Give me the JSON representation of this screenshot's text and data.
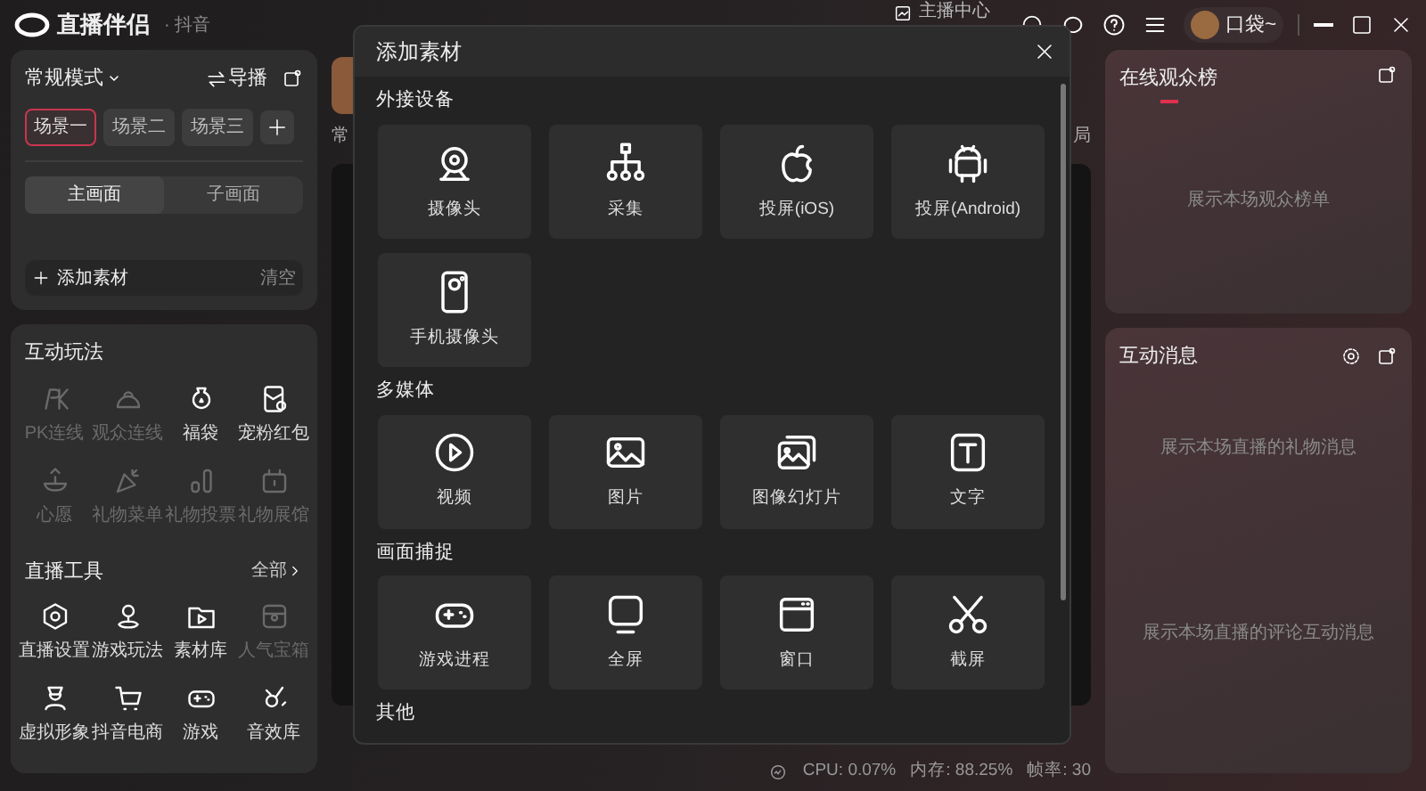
{
  "app": {
    "title": "直播伴侣",
    "platform": "· 抖音"
  },
  "top_bar": {
    "anchor_center": "主播中心",
    "user": "口袋~"
  },
  "scene_panel": {
    "mode": "常规模式",
    "director": "导播",
    "scenes": [
      {
        "label": "场景一",
        "selected": true
      },
      {
        "label": "场景二",
        "selected": false
      },
      {
        "label": "场景三",
        "selected": false
      }
    ],
    "canvas_tabs": [
      {
        "label": "主画面",
        "selected": true
      },
      {
        "label": "子画面",
        "selected": false
      }
    ],
    "add_source": "添加素材",
    "clear": "清空"
  },
  "interactive": {
    "title": "互动玩法",
    "items": [
      {
        "label": "PK连线",
        "disabled": true
      },
      {
        "label": "观众连线",
        "disabled": true
      },
      {
        "label": "福袋",
        "disabled": false
      },
      {
        "label": "宠粉红包",
        "disabled": false
      },
      {
        "label": "心愿",
        "disabled": true
      },
      {
        "label": "礼物菜单",
        "disabled": true
      },
      {
        "label": "礼物投票",
        "disabled": true
      },
      {
        "label": "礼物展馆",
        "disabled": true
      }
    ]
  },
  "live_tools": {
    "title": "直播工具",
    "more": "全部",
    "items": [
      {
        "label": "直播设置",
        "disabled": false
      },
      {
        "label": "游戏玩法",
        "disabled": false
      },
      {
        "label": "素材库",
        "disabled": false
      },
      {
        "label": "人气宝箱",
        "disabled": true
      },
      {
        "label": "虚拟形象",
        "disabled": false
      },
      {
        "label": "抖音电商",
        "disabled": false
      },
      {
        "label": "游戏",
        "disabled": false
      },
      {
        "label": "音效库",
        "disabled": false
      }
    ]
  },
  "center": {
    "left_fragment": "常",
    "right_fragment": "局"
  },
  "status_bar": {
    "cpu": "CPU: 0.07%",
    "memory": "内存: 88.25%",
    "fps": "帧率: 30"
  },
  "audience_rank": {
    "title": "在线观众榜",
    "empty": "展示本场观众榜单"
  },
  "messages": {
    "title": "互动消息",
    "gift_empty": "展示本场直播的礼物消息",
    "comment_empty": "展示本场直播的评论互动消息"
  },
  "dialog": {
    "title": "添加素材",
    "sections": [
      {
        "title": "外接设备",
        "items": [
          {
            "label": "摄像头"
          },
          {
            "label": "采集"
          },
          {
            "label": "投屏(iOS)"
          },
          {
            "label": "投屏(Android)"
          },
          {
            "label": "手机摄像头"
          }
        ]
      },
      {
        "title": "多媒体",
        "items": [
          {
            "label": "视频"
          },
          {
            "label": "图片"
          },
          {
            "label": "图像幻灯片"
          },
          {
            "label": "文字"
          }
        ]
      },
      {
        "title": "画面捕捉",
        "items": [
          {
            "label": "游戏进程"
          },
          {
            "label": "全屏"
          },
          {
            "label": "窗口"
          },
          {
            "label": "截屏"
          }
        ]
      },
      {
        "title": "其他"
      }
    ]
  }
}
